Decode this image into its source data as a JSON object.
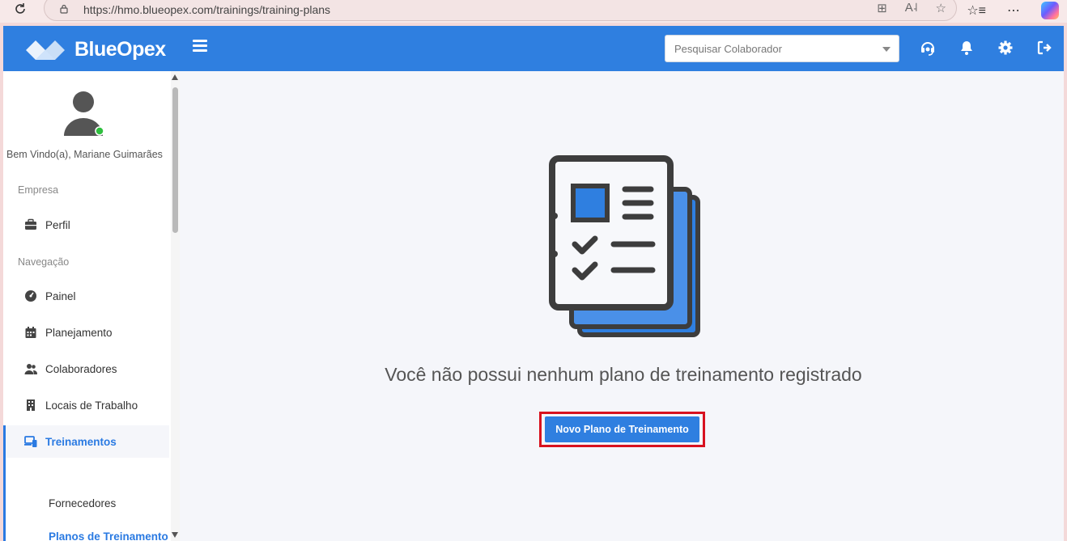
{
  "browser": {
    "url": "https://hmo.blueopex.com/trainings/training-plans"
  },
  "topbar": {
    "brand": "BlueOpex",
    "search_placeholder": "Pesquisar Colaborador",
    "accent_color": "#2f7fe0"
  },
  "sidebar": {
    "welcome": "Bem Vindo(a), Mariane Guimarães",
    "section_company": "Empresa",
    "profile": "Perfil",
    "section_nav": "Navegação",
    "items": [
      {
        "label": "Painel",
        "icon": "dashboard-icon"
      },
      {
        "label": "Planejamento",
        "icon": "calendar-icon"
      },
      {
        "label": "Colaboradores",
        "icon": "users-icon"
      },
      {
        "label": "Locais de Trabalho",
        "icon": "building-icon"
      },
      {
        "label": "Treinamentos",
        "icon": "devices-icon",
        "active": true
      }
    ],
    "subitems": [
      {
        "label": "Fornecedores"
      },
      {
        "label": "Planos de Treinamento",
        "active": true
      }
    ]
  },
  "main": {
    "empty_message": "Você não possui nenhum plano de treinamento registrado",
    "new_plan_button": "Novo Plano de Treinamento",
    "highlight_color": "#d8121f"
  }
}
